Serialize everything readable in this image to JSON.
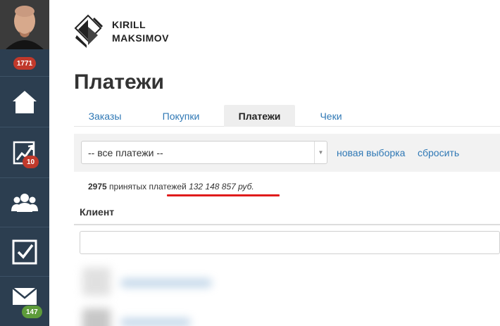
{
  "sidebar": {
    "avatar_badge": "1771",
    "items": [
      {
        "icon": "home-icon"
      },
      {
        "icon": "chart-icon",
        "badge": "10"
      },
      {
        "icon": "users-icon"
      },
      {
        "icon": "checkbox-icon"
      },
      {
        "icon": "mail-icon",
        "badge": "147"
      }
    ]
  },
  "brand": {
    "line1": "KIRILL",
    "line2": "MAKSIMOV"
  },
  "page": {
    "title": "Платежи"
  },
  "tabs": [
    {
      "label": "Заказы"
    },
    {
      "label": "Покупки"
    },
    {
      "label": "Платежи",
      "active": true
    },
    {
      "label": "Чеки"
    }
  ],
  "filter": {
    "select_value": "-- все платежи --",
    "new_selection": "новая выборка",
    "reset": "сбросить"
  },
  "summary": {
    "count": "2975",
    "label": "принятых платежей",
    "total": "132 148 857 руб."
  },
  "table": {
    "client_header": "Клиент"
  },
  "colors": {
    "sidebar": "#2c3e50",
    "link": "#2f78b5",
    "badge_red": "#c0392b",
    "badge_green": "#5d9b3a",
    "highlight_underline": "#e01b1b"
  }
}
